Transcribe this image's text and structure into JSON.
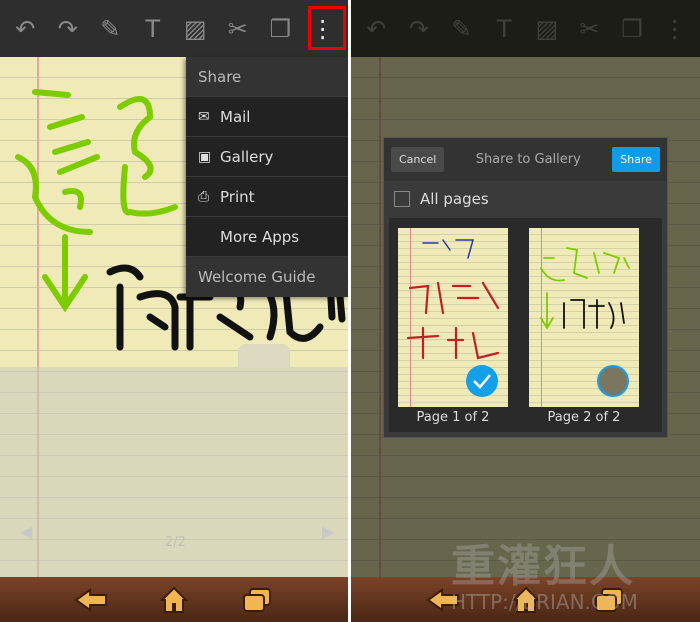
{
  "left": {
    "toolbar": [
      "undo-icon",
      "redo-icon",
      "pen-icon",
      "text-icon",
      "image-icon",
      "scissors-icon",
      "pages-icon",
      "more-vert-icon"
    ],
    "menu": {
      "header": "Share",
      "items": [
        {
          "label": "Mail",
          "icon": "mail-icon"
        },
        {
          "label": "Gallery",
          "icon": "gallery-icon"
        },
        {
          "label": "Print",
          "icon": "print-icon"
        },
        {
          "label": "More Apps",
          "icon": ""
        }
      ],
      "footer": "Welcome Guide"
    },
    "page_indicator": "2/2"
  },
  "right": {
    "dialog": {
      "cancel": "Cancel",
      "title": "Share to Gallery",
      "share": "Share",
      "all_pages": "All pages",
      "all_pages_checked": false,
      "pages": [
        {
          "label": "Page 1 of 2",
          "selected": true
        },
        {
          "label": "Page 2 of 2",
          "selected": false
        }
      ]
    },
    "watermark": {
      "text": "重灌狂人",
      "url": "HTTP://BRIAN.COM"
    }
  },
  "colors": {
    "accent": "#0f9be6",
    "highlight": "#e00000",
    "ink_green": "#7ccc00"
  }
}
